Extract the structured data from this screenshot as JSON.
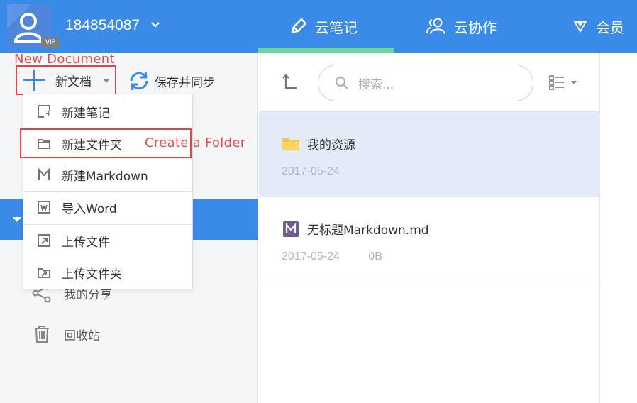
{
  "header": {
    "user_id": "184854087",
    "vip_badge": "VIP",
    "tabs": [
      {
        "label": "云笔记",
        "icon": "pencil-icon"
      },
      {
        "label": "云协作",
        "icon": "people-icon"
      },
      {
        "label": "会员",
        "icon": "diamond-icon"
      }
    ],
    "accent_color": "#3a8ae8",
    "active_tab_underline_color": "#6fd49a"
  },
  "annotations": {
    "new_document": "New Document",
    "create_folder": "Create a Folder",
    "color": "#e05050"
  },
  "toolbar": {
    "new_doc_label": "新文档",
    "sync_label": "保存并同步"
  },
  "menu": {
    "items": [
      {
        "label": "新建笔记",
        "icon": "new-note-icon"
      },
      {
        "label": "新建文件夹",
        "icon": "folder-outline-icon"
      },
      {
        "label": "新建Markdown",
        "icon": "markdown-m-icon"
      },
      {
        "label": "导入Word",
        "icon": "import-word-icon"
      },
      {
        "label": "上传文件",
        "icon": "upload-file-icon"
      },
      {
        "label": "上传文件夹",
        "icon": "upload-folder-icon"
      }
    ]
  },
  "sidebar": {
    "items": [
      {
        "label": "我的分享",
        "icon": "share-icon"
      },
      {
        "label": "回收站",
        "icon": "trash-icon"
      }
    ]
  },
  "list": {
    "search_placeholder": "搜索...",
    "items": [
      {
        "title": "我的资源",
        "date": "2017-05-24",
        "size": "",
        "icon": "folder-icon"
      },
      {
        "title": "无标题Markdown.md",
        "date": "2017-05-24",
        "size": "0B",
        "icon": "markdown-file-icon"
      }
    ]
  }
}
